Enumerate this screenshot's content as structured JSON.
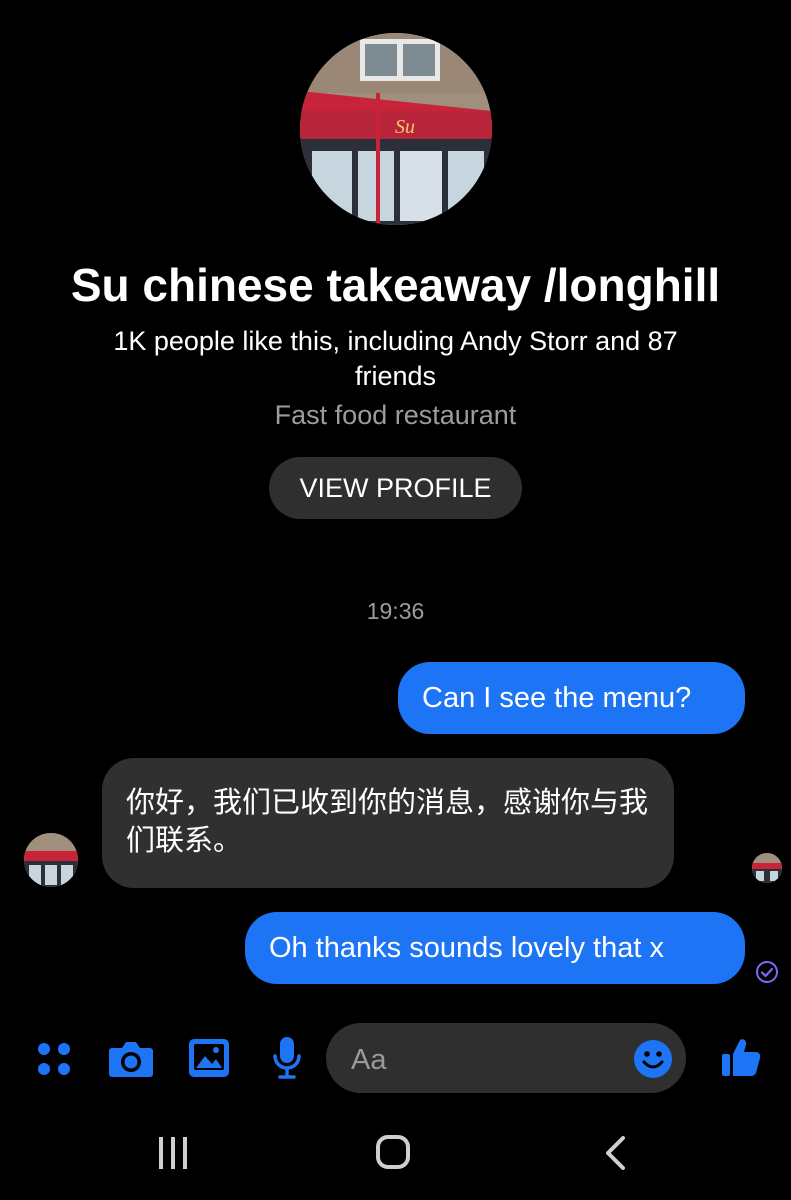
{
  "profile": {
    "name": "Su chinese takeaway /longhill",
    "likes": "1K people like this, including Andy Storr and 87 friends",
    "category": "Fast food restaurant",
    "view_profile_label": "VIEW PROFILE",
    "sign_text": "Su"
  },
  "conversation": {
    "timestamp": "19:36",
    "messages": [
      {
        "direction": "outgoing",
        "text": "Can I see the menu?"
      },
      {
        "direction": "incoming",
        "text": "你好，我们已收到你的消息，感谢你与我们联系。"
      },
      {
        "direction": "outgoing",
        "text": "Oh thanks sounds lovely that x"
      }
    ]
  },
  "composer": {
    "placeholder": "Aa",
    "icons": [
      "apps-icon",
      "camera-icon",
      "gallery-icon",
      "microphone-icon",
      "emoji-icon",
      "thumbs-up-icon"
    ]
  },
  "navbar": {
    "icons": [
      "recent-apps-icon",
      "home-icon",
      "back-icon"
    ]
  },
  "colors": {
    "background": "#000000",
    "accent": "#1d74f5",
    "incoming_bubble": "#303030",
    "button_bg": "#2f2f2f",
    "muted_text": "#9c9c9c"
  }
}
